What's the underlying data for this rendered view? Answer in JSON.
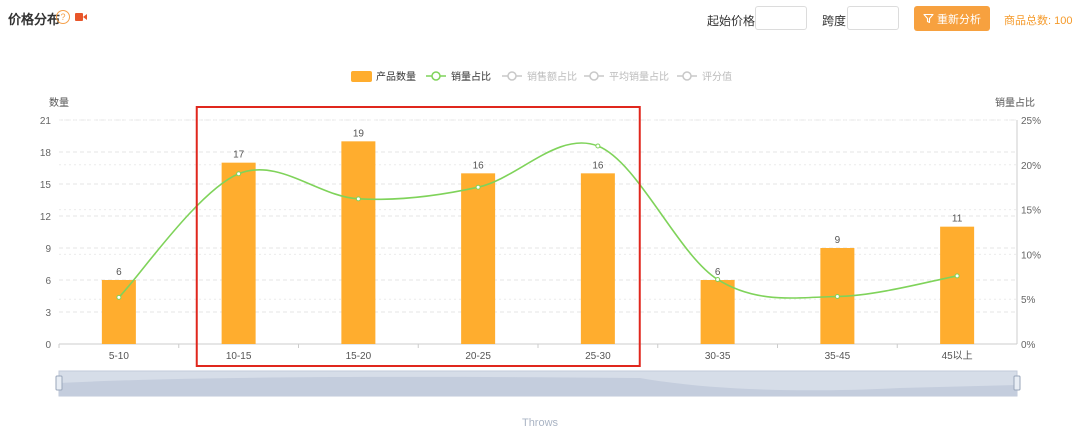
{
  "header": {
    "title": "价格分布",
    "help_glyph": "?",
    "start_price_label": "起始价格",
    "start_price_value": "",
    "step_label": "跨度",
    "step_value": "",
    "reanalyze_label": "重新分析",
    "total_label": "商品总数",
    "total_value": "100"
  },
  "colors": {
    "accent": "#f7a13f",
    "bar": "#ffad2e",
    "line": "#7fd35a",
    "inactive": "#c8c8c8"
  },
  "chart_data": {
    "type": "bar",
    "categories": [
      "5-10",
      "10-15",
      "15-20",
      "20-25",
      "25-30",
      "30-35",
      "35-45",
      "45以上"
    ],
    "series": [
      {
        "name": "产品数量",
        "type": "bar",
        "axis": "left",
        "values": [
          6,
          17,
          19,
          16,
          16,
          6,
          9,
          11
        ]
      },
      {
        "name": "销量占比",
        "type": "line",
        "axis": "right",
        "values": [
          5.2,
          19.0,
          16.2,
          17.5,
          22.1,
          7.2,
          5.3,
          7.6
        ]
      }
    ],
    "legend": [
      {
        "name": "产品数量",
        "active": true,
        "kind": "bar"
      },
      {
        "name": "销量占比",
        "active": true,
        "kind": "line"
      },
      {
        "name": "销售额占比",
        "active": false,
        "kind": "line"
      },
      {
        "name": "平均销量占比",
        "active": false,
        "kind": "line"
      },
      {
        "name": "评分值",
        "active": false,
        "kind": "line"
      }
    ],
    "legend_position": "top-center",
    "ylabel_left": "数量",
    "ylabel_right": "销量占比",
    "ylim_left": [
      0,
      21
    ],
    "yticks_left": [
      "0",
      "3",
      "6",
      "9",
      "12",
      "15",
      "18",
      "21"
    ],
    "ylim_right": [
      0,
      25
    ],
    "yticks_right": [
      "0%",
      "5%",
      "10%",
      "15%",
      "20%",
      "25%"
    ],
    "highlight_range": [
      "10-15",
      "25-30"
    ],
    "zoom_slider_label": "Throws",
    "grid": true
  }
}
